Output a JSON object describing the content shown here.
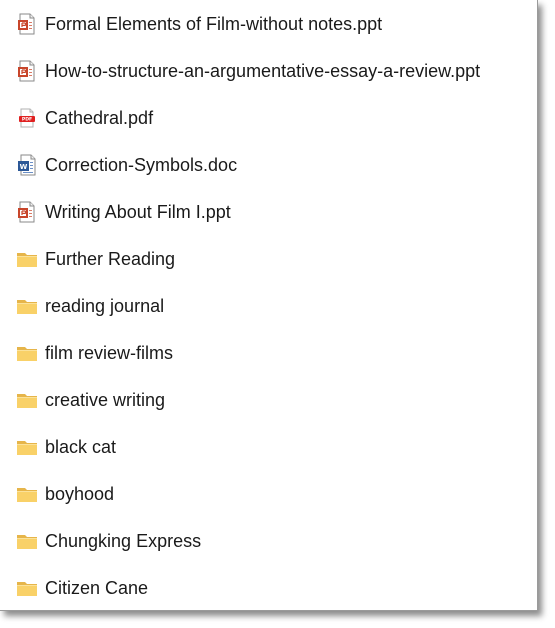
{
  "items": [
    {
      "name": "Formal Elements of Film-without notes.ppt",
      "icon": "ppt-file-icon"
    },
    {
      "name": "How-to-structure-an-argumentative-essay-a-review.ppt",
      "icon": "ppt-file-icon"
    },
    {
      "name": "Cathedral.pdf",
      "icon": "pdf-file-icon"
    },
    {
      "name": "Correction-Symbols.doc",
      "icon": "word-file-icon"
    },
    {
      "name": "Writing About Film I.ppt",
      "icon": "ppt-file-icon"
    },
    {
      "name": "Further Reading",
      "icon": "folder-icon"
    },
    {
      "name": "reading journal",
      "icon": "folder-icon"
    },
    {
      "name": "film review-films",
      "icon": "folder-icon"
    },
    {
      "name": "creative writing",
      "icon": "folder-icon"
    },
    {
      "name": "black cat",
      "icon": "folder-icon"
    },
    {
      "name": "boyhood",
      "icon": "folder-icon"
    },
    {
      "name": "Chungking Express",
      "icon": "folder-icon"
    },
    {
      "name": "Citizen Cane",
      "icon": "folder-icon"
    }
  ],
  "pdf_badge_text": "PDF",
  "word_badge_text": "W",
  "colors": {
    "ppt_accent": "#c8462b",
    "pdf_accent": "#e02020",
    "word_accent": "#2b5797",
    "folder_fill": "#f9d168",
    "folder_tab": "#e6b54a",
    "text": "#1a1a1a"
  }
}
